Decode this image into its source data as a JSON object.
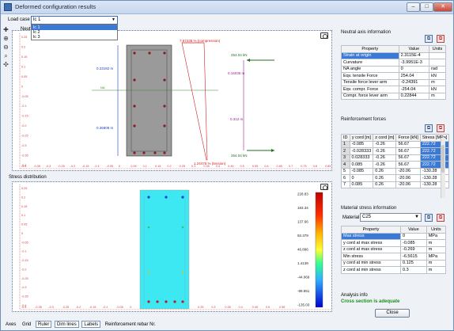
{
  "window": {
    "title": "Deformed configuration results",
    "btn_min": "–",
    "btn_max": "□",
    "btn_close": "✕"
  },
  "load_case": {
    "label": "Load case",
    "selected": "lc 1",
    "options": [
      "lc 1",
      "lc 2",
      "lc 3"
    ]
  },
  "neutral_plot": {
    "label": "Neutral",
    "compress_label": "7.67238 % (compression)",
    "tension_label": "1.24475 % (tension)",
    "dim_top": "0.23192 m",
    "dim_bottom": "0.36808 m",
    "na": "NA",
    "force_top": "254.04 kN",
    "force_bottom": "254.04 kN",
    "arm_top": "0.16036 m",
    "arm_total": "0.312 m",
    "y_ticks": [
      "0.25",
      "0.2",
      "0.15",
      "0.1",
      "0.05",
      "0",
      "-0.05",
      "-0.1",
      "-0.15",
      "-0.2",
      "-0.25",
      "-0.3",
      "-0.35",
      "-0.4"
    ],
    "x_ticks": [
      "-0.4",
      "-0.35",
      "-0.3",
      "-0.25",
      "-0.2",
      "-0.15",
      "-0.1",
      "-0.05",
      "0",
      "0.05",
      "0.1",
      "0.15",
      "0.2",
      "0.25",
      "0.3",
      "0.35",
      "0.4",
      "0.45",
      "0.5",
      "0.55",
      "0.6",
      "0.65",
      "0.7",
      "0.75",
      "0.8",
      "0.85"
    ]
  },
  "stress_plot": {
    "label": "Stress distribution",
    "legend_values": [
      "228.83",
      "183.34",
      "137.66",
      "92.379",
      "46.896",
      "1.4139",
      "-44.069",
      "-89.551",
      "-135.03"
    ],
    "y_ticks": [
      "0.25",
      "0.2",
      "0.15",
      "0.1",
      "0.05",
      "0",
      "-0.05",
      "-0.1",
      "-0.15",
      "-0.2",
      "-0.25",
      "-0.3",
      "-0.35",
      "-0.4"
    ],
    "x_ticks": [
      "-0.4",
      "-0.35",
      "-0.3",
      "-0.25",
      "-0.2",
      "-0.15",
      "-0.1",
      "-0.05",
      "0",
      "0.05",
      "0.1",
      "0.15",
      "0.2",
      "0.25",
      "0.3",
      "0.35",
      "0.4",
      "0.45",
      "0.5",
      "0.55"
    ]
  },
  "bottom_tabs": [
    "Axes",
    "Grid",
    "Ruler",
    "Dim lines",
    "Labels",
    "Reinforcement rebar Nr."
  ],
  "neutral_axis": {
    "title": "Neutral axis information",
    "headers": [
      "Property",
      "Value",
      "Units"
    ],
    "rows": [
      [
        "Strain at origin",
        "2.3115E-4",
        ""
      ],
      [
        "Curvature",
        "-3.9951E-3",
        ""
      ],
      [
        "NA angle",
        "0",
        "rad"
      ],
      [
        "Eqv. tensile Force",
        "254.04",
        "kN"
      ],
      [
        "Tensile force lever arm",
        "-0.24391",
        "m"
      ],
      [
        "Eqv. compr. Force",
        "-254.04",
        "kN"
      ],
      [
        "Compr. force lever arm",
        "0.22844",
        "m"
      ]
    ]
  },
  "reinforcement": {
    "title": "Reinforcement forces",
    "headers": [
      "ID",
      "y cord [m]",
      "z cord [m]",
      "Force [kN]",
      "Stress [MPa]"
    ],
    "rows": [
      [
        "1",
        "-0.085",
        "-0.26",
        "56.67",
        "222.72"
      ],
      [
        "2",
        "-0.028333",
        "-0.26",
        "56.67",
        "222.72"
      ],
      [
        "3",
        "0.028333",
        "-0.26",
        "56.67",
        "222.72"
      ],
      [
        "4",
        "0.085",
        "-0.26",
        "56.67",
        "222.72"
      ],
      [
        "5",
        "-0.085",
        "0.26",
        "-20.06",
        "-130.28"
      ],
      [
        "6",
        "0",
        "0.26",
        "-20.06",
        "-130.28"
      ],
      [
        "7",
        "0.085",
        "0.26",
        "-20.06",
        "-130.28"
      ]
    ]
  },
  "material": {
    "title": "Material stress information",
    "label": "Material",
    "selected": "C25",
    "headers": [
      "Property",
      "Value",
      "Units"
    ],
    "rows": [
      [
        "Max stress",
        "0",
        "MPa"
      ],
      [
        "y cord at max stress",
        "-0.085",
        "m"
      ],
      [
        "z cord at max stress",
        "-0.269",
        "m"
      ],
      [
        "Min stress",
        "-6.5615",
        "MPa"
      ],
      [
        "y cord at min stress",
        "0.125",
        "m"
      ],
      [
        "z cord at min stress",
        "0.3",
        "m"
      ]
    ]
  },
  "analysis": {
    "title": "Analysis info",
    "message": "Cross section is adequate"
  },
  "close_label": "Close",
  "colors": {
    "highlight": "#3b79d6",
    "section_fill": "#9a9a9a",
    "stress_fill": "#3ee8f2",
    "ok": "#1a8f1a"
  }
}
